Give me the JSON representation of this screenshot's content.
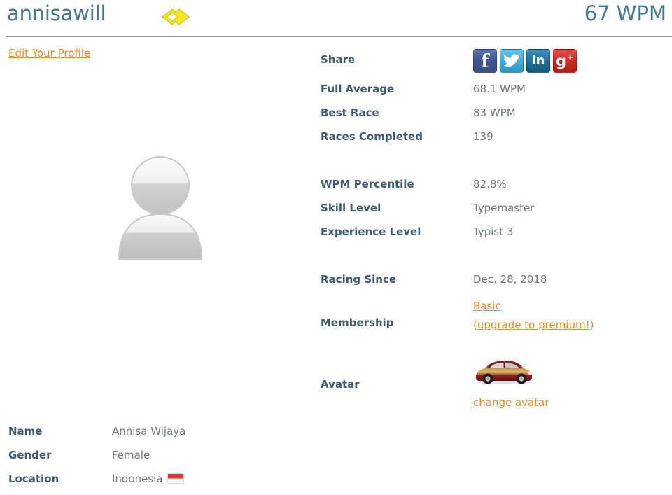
{
  "header": {
    "username": "annisawill",
    "badge_icon": "double-diamond-icon",
    "wpm": "67 WPM",
    "edit_profile_link": "Edit Your Profile"
  },
  "profile": {
    "avatar_placeholder_icon": "person-silhouette-icon"
  },
  "stats": {
    "share_label": "Share",
    "social": [
      {
        "name": "facebook-share-icon",
        "glyph": "f",
        "color": "#3b5998"
      },
      {
        "name": "twitter-share-icon",
        "glyph": "bird",
        "color": "#3fa9d4"
      },
      {
        "name": "linkedin-share-icon",
        "glyph": "in",
        "color": "#1f6f96"
      },
      {
        "name": "googleplus-share-icon",
        "glyph": "g+",
        "color": "#ca2b20"
      }
    ],
    "rows": [
      {
        "label": "Full Average",
        "value": "68.1 WPM"
      },
      {
        "label": "Best Race",
        "value": "83 WPM"
      },
      {
        "label": "Races Completed",
        "value": "139"
      }
    ],
    "rows2": [
      {
        "label": "WPM Percentile",
        "value": "82.8%"
      },
      {
        "label": "Skill Level",
        "value": "Typemaster"
      },
      {
        "label": "Experience Level",
        "value": "Typist 3"
      }
    ],
    "racing_since_label": "Racing Since",
    "racing_since_value": "Dec. 28, 2018",
    "membership_label": "Membership",
    "membership_value": "Basic",
    "membership_upgrade_open": "(",
    "membership_upgrade": "upgrade to premium!",
    "membership_upgrade_close": ")"
  },
  "avatar": {
    "label": "Avatar",
    "image_icon": "red-beetle-car-icon",
    "change_link": "change avatar"
  },
  "personal": {
    "rows": [
      {
        "label": "Name",
        "value": "Annisa Wijaya"
      },
      {
        "label": "Gender",
        "value": "Female"
      },
      {
        "label": "Location",
        "value": "Indonesia"
      }
    ],
    "flag_icon": "indonesia-flag-icon"
  },
  "colors": {
    "link": "#f08a28",
    "label": "#3d5a6c",
    "value": "#6d7880",
    "username": "#44788f",
    "badge": "#f2e21e"
  }
}
